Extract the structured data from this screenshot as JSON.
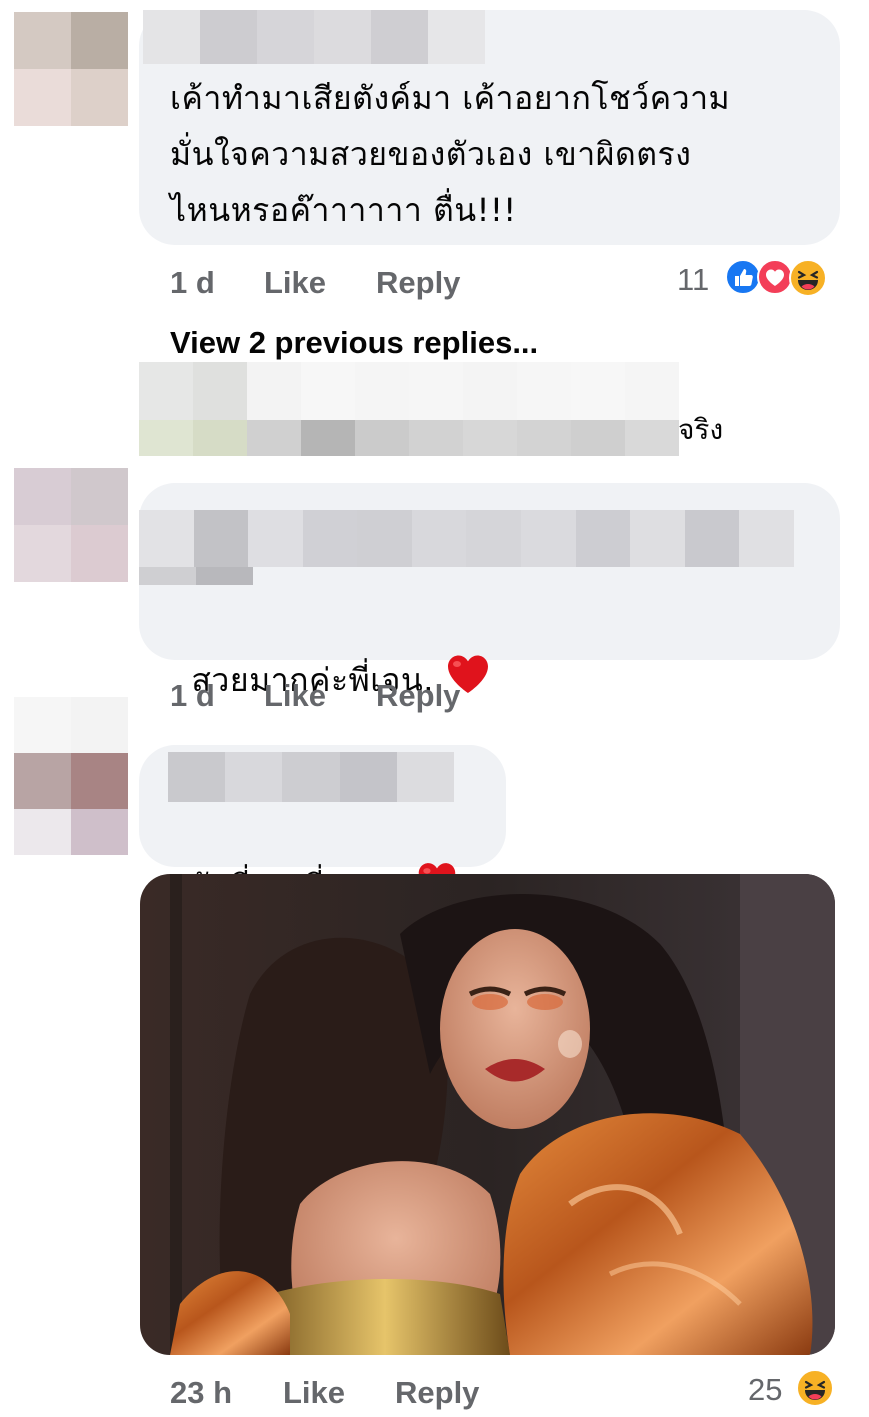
{
  "comments": [
    {
      "text_lines": [
        "เค้าทำมาเสียตังค์มา เค้าอยากโชว์ความ",
        "มั่นใจความสวยของตัวเอง เขาผิดตรง",
        "ไหนหรอค๊าาาาาา ตื่น!!!"
      ],
      "time": "1 d",
      "like": "Like",
      "reply": "Reply",
      "reaction_count": "11",
      "reaction_icons": [
        "like-icon",
        "love-icon",
        "haha-icon"
      ]
    },
    {
      "text": "สวยมากค่ะพี่เจน..",
      "time": "1 d",
      "like": "Like",
      "reply": "Reply"
    },
    {
      "text": "รักพี่เจนนี่นะคะ",
      "time": "23 h",
      "like": "Like",
      "reply": "Reply",
      "reaction_count": "25",
      "reaction_icons": [
        "haha-icon"
      ],
      "attachment": "photo-two-women-hugging-orange-satin-dresses"
    }
  ],
  "view_previous_replies": "View 2 previous replies...",
  "reply_preview_tail": "จริง",
  "colors": {
    "bubble": "#f0f2f5",
    "meta_text": "#65676b",
    "like_blue": "#1877f2",
    "love_red": "#f33e58",
    "haha_yellow": "#f7b125"
  }
}
